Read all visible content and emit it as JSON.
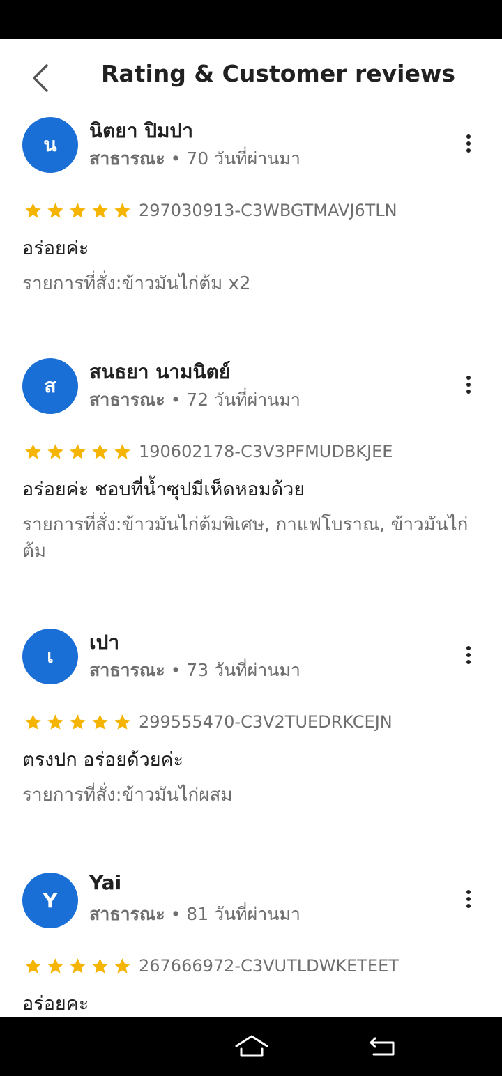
{
  "header": {
    "title": "Rating & Customer reviews",
    "back_icon": "chevron-left-icon"
  },
  "colors": {
    "avatar_bg": "#1a6fd6",
    "star": "#f5b400",
    "primary_text": "#212121",
    "secondary_text": "#6e6e6e"
  },
  "reviews": [
    {
      "avatar_letter": "น",
      "name": "นิตยา ปิมปา",
      "visibility": "สาธารณะ",
      "separator": " • ",
      "time_ago": "70 วันที่ผ่านมา",
      "rating": 5,
      "order_code": "297030913-C3WBGTMAVJ6TLN",
      "comment": "อร่อยค่ะ",
      "order_items": "รายการที่สั่ง:ข้าวมันไก่ต้ม x2"
    },
    {
      "avatar_letter": "ส",
      "name": "สนธยา นามนิตย์",
      "visibility": "สาธารณะ",
      "separator": " • ",
      "time_ago": "72 วันที่ผ่านมา",
      "rating": 5,
      "order_code": "190602178-C3V3PFMUDBKJEE",
      "comment": "อร่อยค่ะ ชอบที่น้ำซุปมีเห็ดหอมด้วย",
      "order_items": "รายการที่สั่ง:ข้าวมันไก่ต้มพิเศษ, กาแฟโบราณ, ข้าวมันไก่ต้ม"
    },
    {
      "avatar_letter": "เ",
      "name": "เปา",
      "visibility": "สาธารณะ",
      "separator": " • ",
      "time_ago": "73 วันที่ผ่านมา",
      "rating": 5,
      "order_code": "299555470-C3V2TUEDRKCEJN",
      "comment": "ตรงปก อร่อยด้วยค่ะ",
      "order_items": "รายการที่สั่ง:ข้าวมันไก่ผสม"
    },
    {
      "avatar_letter": "Y",
      "name": "Yai",
      "visibility": "สาธารณะ",
      "separator": " • ",
      "time_ago": "81 วันที่ผ่านมา",
      "rating": 5,
      "order_code": "267666972-C3VUTLDWKETEET",
      "comment": "อร่อยคะ",
      "order_items": ""
    }
  ],
  "nav_bar": {
    "home_icon": "home-icon",
    "back_icon": "back-arrow-icon"
  }
}
